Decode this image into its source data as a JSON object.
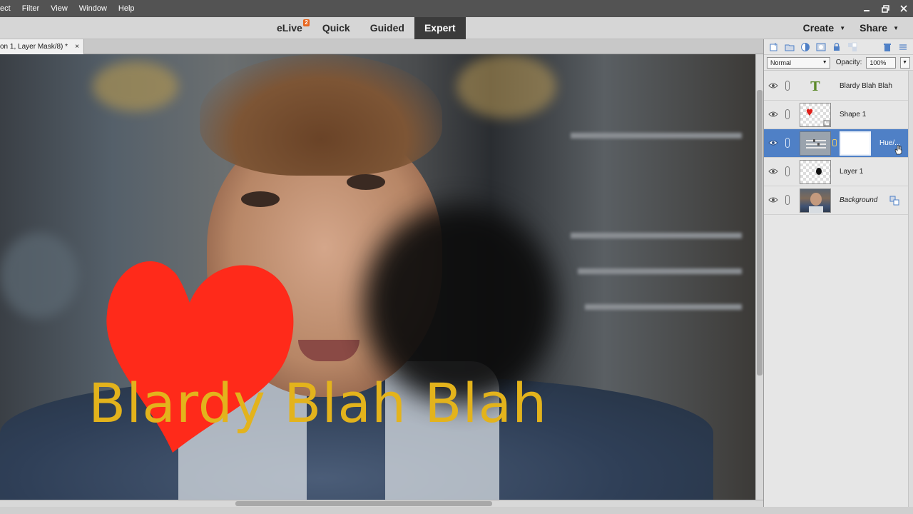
{
  "menu": {
    "items": [
      "ect",
      "Filter",
      "View",
      "Window",
      "Help"
    ]
  },
  "modes": {
    "items": [
      {
        "label": "eLive",
        "badge": "2"
      },
      {
        "label": "Quick"
      },
      {
        "label": "Guided"
      },
      {
        "label": "Expert",
        "active": true
      }
    ]
  },
  "header": {
    "create_label": "Create",
    "share_label": "Share"
  },
  "document_tab": {
    "title": "on 1, Layer Mask/8) *",
    "close": "×"
  },
  "canvas": {
    "text_layer_content": "Blardy Blah Blah",
    "text_color": "#e3b31c",
    "heart_color": "#ff2a1a"
  },
  "layers_panel": {
    "blend_mode": "Normal",
    "opacity_label": "Opacity:",
    "opacity_value": "100%",
    "layers": [
      {
        "name": "Blardy Blah Blah",
        "type": "text"
      },
      {
        "name": "Shape 1",
        "type": "shape"
      },
      {
        "name": "Hue/...",
        "type": "adjustment",
        "active": true
      },
      {
        "name": "Layer 1",
        "type": "pixel"
      },
      {
        "name": "Background",
        "type": "background"
      }
    ]
  },
  "colors": {
    "accent_blue": "#4f80c6",
    "active_mode_bg": "#3b3b3b",
    "badge_orange": "#e8671f"
  }
}
